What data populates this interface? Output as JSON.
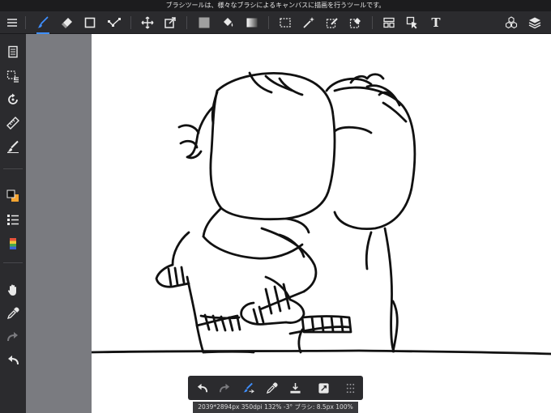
{
  "tooltip": "ブラシツールは、様々なブラシによるキャンバスに描画を行うツールです。",
  "status_bar": "2039*2894px 350dpi 132% -3° ブラシ: 8.5px 100%",
  "toolbar": {
    "text_tool_label": "T",
    "active_tool": "brush-tool",
    "accent_color": "#3f8fff",
    "icons": [
      "menu-icon",
      "brush-icon",
      "eraser-icon",
      "rectangle-icon",
      "vector-icon",
      "move-icon",
      "transform-icon",
      "fill-color-icon",
      "bucket-icon",
      "gradient-icon",
      "select-rect-icon",
      "magic-wand-icon",
      "select-pen-icon",
      "select-eraser-icon",
      "panel-layout-icon",
      "operation-icon",
      "text-icon",
      "material-icon",
      "layers-icon"
    ]
  },
  "sidebar": {
    "icons": [
      "page-icon",
      "selection-icon",
      "rotate-icon",
      "ruler-icon",
      "snap-brush-icon",
      "color-swatch-icon",
      "brush-list-icon",
      "palette-icon",
      "hand-icon",
      "eyedropper-icon",
      "redo-icon",
      "undo-icon"
    ],
    "foreground_color": "#111111",
    "background_color": "#f5a431"
  },
  "bottom_bar": {
    "icons": [
      "undo-icon",
      "redo-icon",
      "brush-fix-icon",
      "eyedropper-icon",
      "fill-icon",
      "transform-icon",
      "grid-icon"
    ]
  }
}
